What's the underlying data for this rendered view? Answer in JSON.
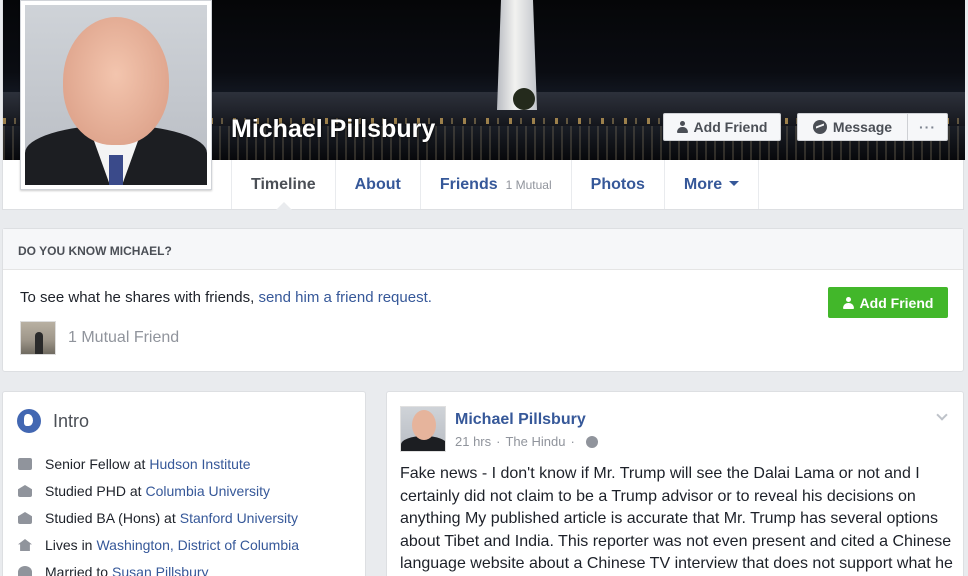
{
  "profile": {
    "name": "Michael Pillsbury",
    "actions": {
      "add_friend": "Add Friend",
      "message": "Message",
      "more": "···"
    }
  },
  "tabs": [
    {
      "label": "Timeline"
    },
    {
      "label": "About"
    },
    {
      "label": "Friends",
      "sub": "1 Mutual"
    },
    {
      "label": "Photos"
    },
    {
      "label": "More"
    }
  ],
  "know": {
    "heading": "DO YOU KNOW MICHAEL?",
    "text": "To see what he shares with friends, ",
    "link": "send him a friend request.",
    "button": "Add Friend",
    "mutual": "1 Mutual Friend"
  },
  "intro": {
    "title": "Intro",
    "rows": [
      {
        "icon": "briefcase-icon",
        "text": "Senior Fellow at",
        "link": "Hudson Institute"
      },
      {
        "icon": "graduation-cap-icon",
        "text": "Studied PHD at",
        "link": "Columbia University"
      },
      {
        "icon": "graduation-cap-icon",
        "text": "Studied BA (Hons) at",
        "link": "Stanford University"
      },
      {
        "icon": "home-icon",
        "text": "Lives in",
        "link": "Washington, District of Columbia"
      },
      {
        "icon": "heart-icon",
        "text": "Married to",
        "link": "Susan Pillsbury"
      }
    ]
  },
  "post": {
    "author": "Michael Pillsbury",
    "time": "21 hrs",
    "source": "The Hindu",
    "text": "Fake news - I don't know if Mr. Trump will see the Dalai Lama or not and I certainly did not claim to be a Trump advisor or to reveal his decisions on anything My published article is accurate that Mr. Trump has several options about Tibet and India. This reporter was not even present and cited a Chinese language website about a Chinese TV interview that does not support what he"
  },
  "colors": {
    "link": "#365899",
    "green_button": "#42b72a",
    "background": "#e9ebee"
  }
}
